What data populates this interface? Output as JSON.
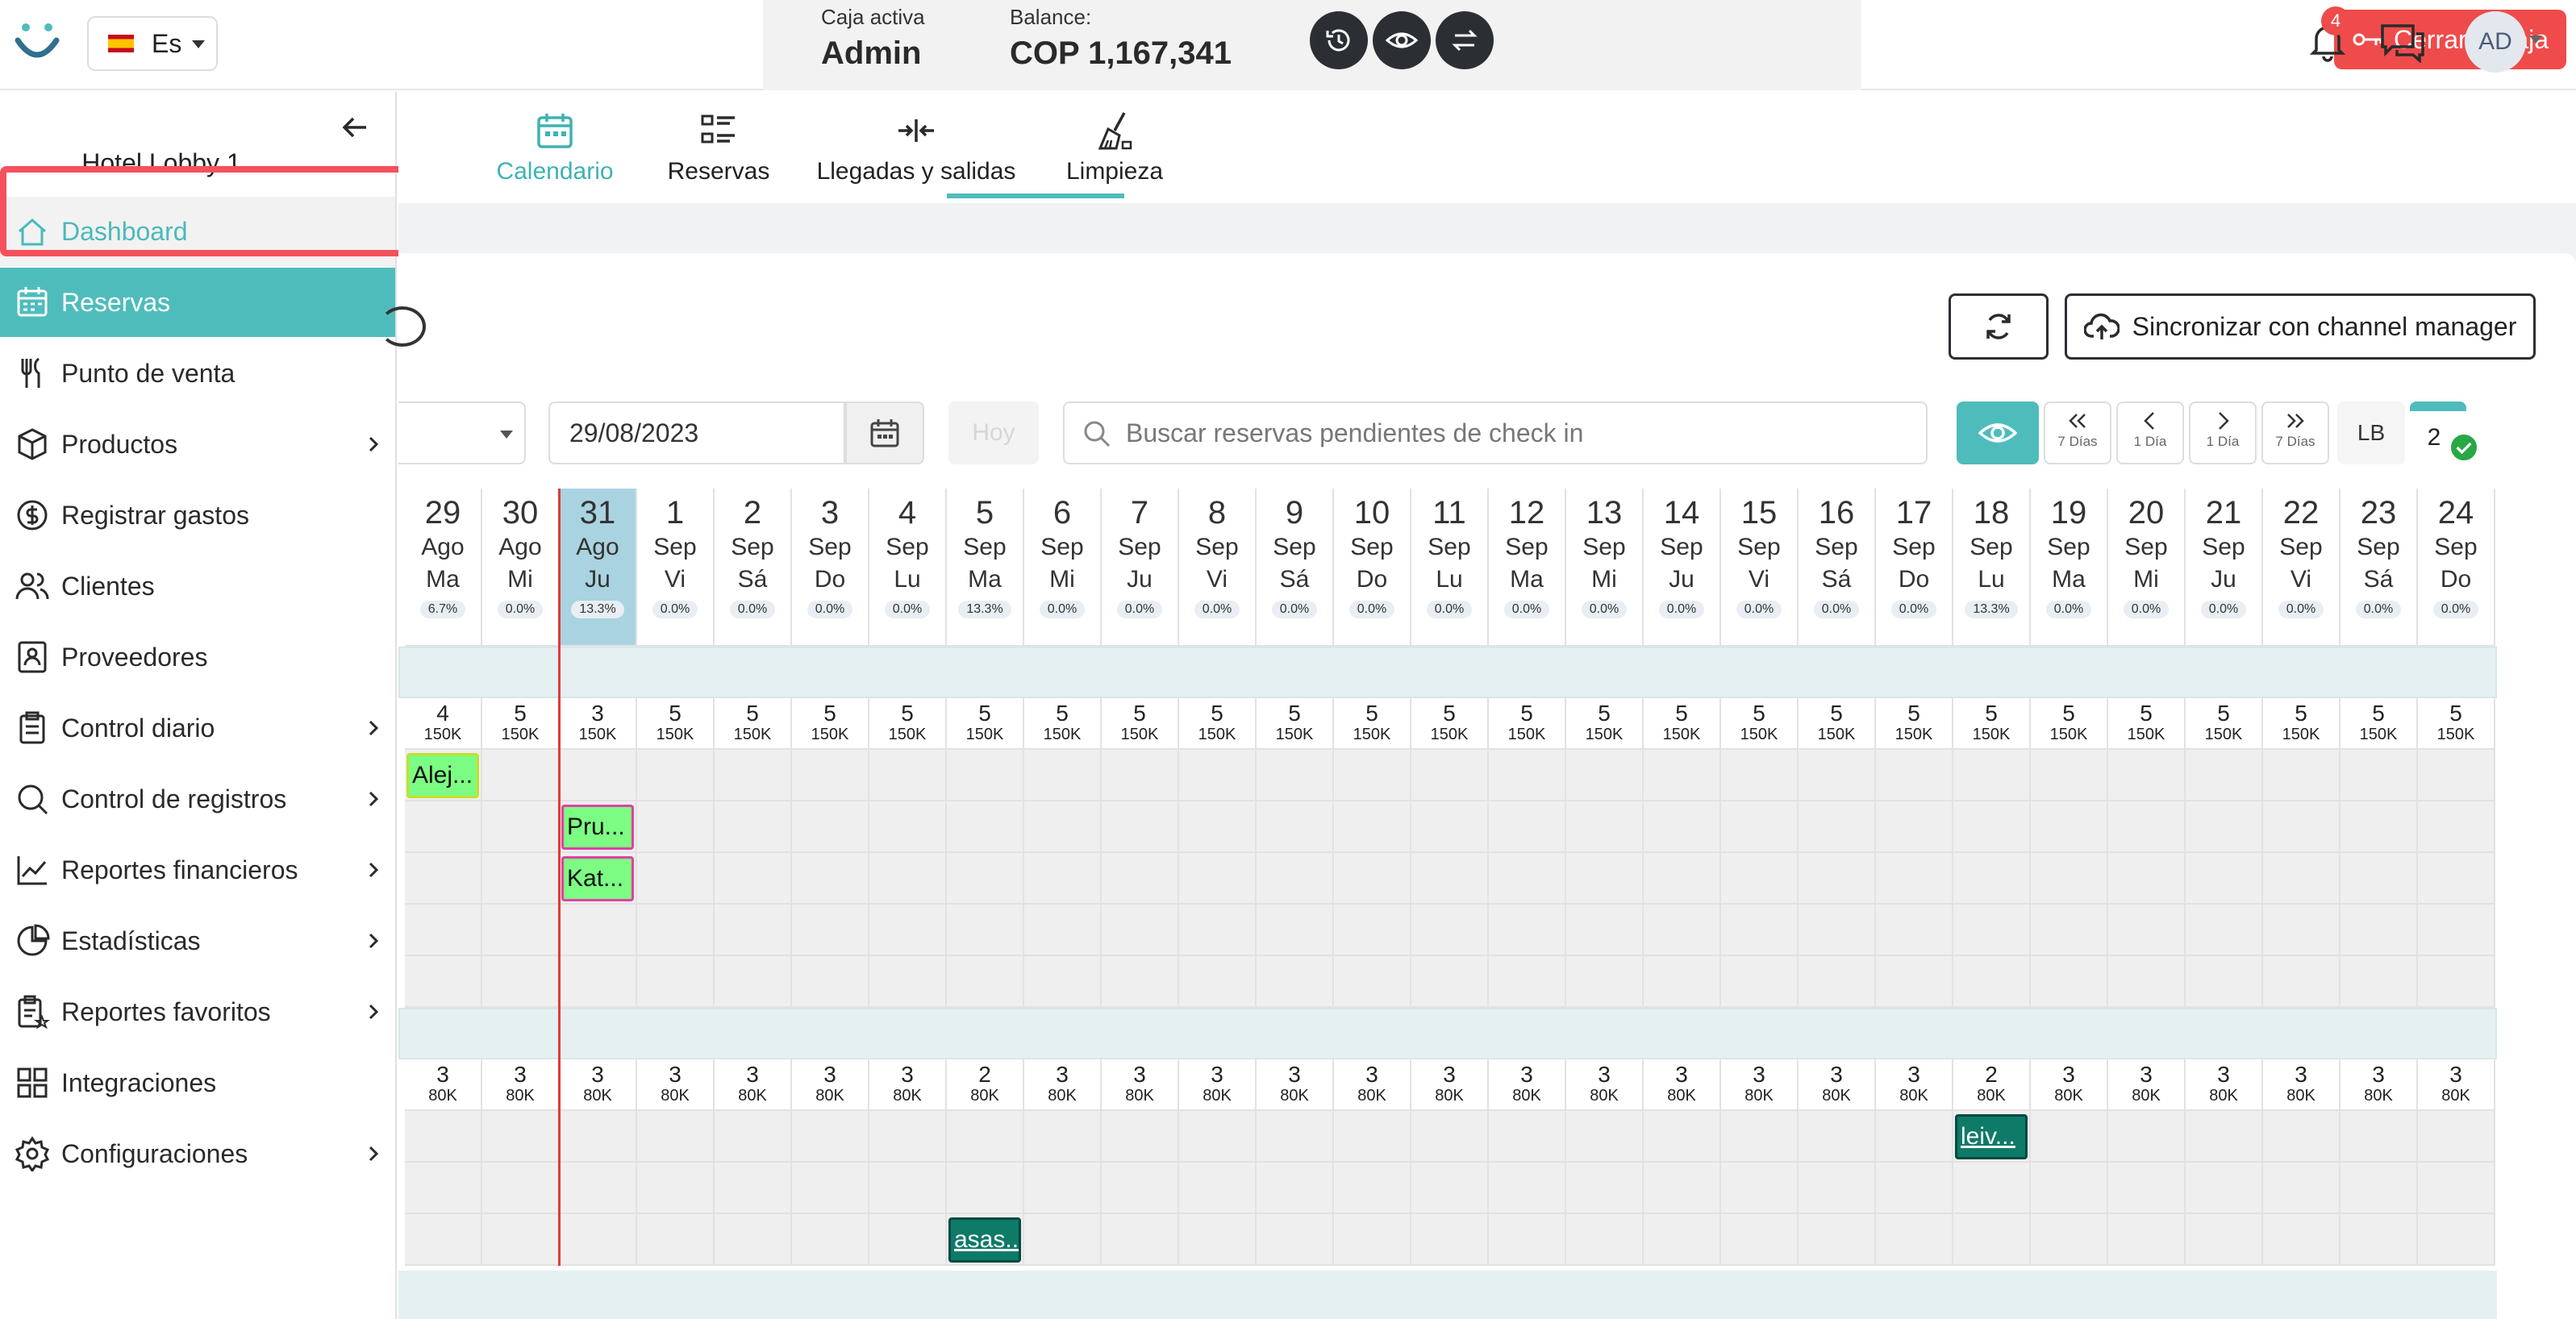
{
  "header": {
    "language": "Es",
    "cash": {
      "active_label": "Caja activa",
      "active_value": "Admin",
      "balance_label": "Balance:",
      "balance_value": "COP 1,167,341"
    },
    "close_cash_label": "Cerrar la caja",
    "notifications_count": "4",
    "avatar_initials": "AD"
  },
  "sidebar": {
    "hotel_name": "Hotel Lobby 1",
    "items": [
      {
        "label": "Dashboard",
        "icon": "home-icon"
      },
      {
        "label": "Reservas",
        "icon": "calendar-icon"
      },
      {
        "label": "Punto de venta",
        "icon": "utensils-icon"
      },
      {
        "label": "Productos",
        "icon": "box-icon"
      },
      {
        "label": "Registrar gastos",
        "icon": "dollar-circle-icon"
      },
      {
        "label": "Clientes",
        "icon": "users-icon"
      },
      {
        "label": "Proveedores",
        "icon": "contact-card-icon"
      },
      {
        "label": "Control diario",
        "icon": "clipboard-icon"
      },
      {
        "label": "Control de registros",
        "icon": "search-icon"
      },
      {
        "label": "Reportes financieros",
        "icon": "line-chart-icon"
      },
      {
        "label": "Estadísticas",
        "icon": "pie-chart-icon"
      },
      {
        "label": "Reportes favoritos",
        "icon": "clipboard-star-icon"
      },
      {
        "label": "Integraciones",
        "icon": "grid-icon"
      },
      {
        "label": "Configuraciones",
        "icon": "gear-icon"
      }
    ]
  },
  "tabs": [
    {
      "label": "Calendario",
      "icon": "calendar-icon"
    },
    {
      "label": "Reservas",
      "icon": "list-icon"
    },
    {
      "label": "Llegadas y salidas",
      "icon": "arrows-icon"
    },
    {
      "label": "Limpieza",
      "icon": "broom-icon"
    }
  ],
  "toolbar": {
    "sync_label": "Sincronizar con channel manager",
    "date_value": "29/08/2023",
    "today_label": "Hoy",
    "search_placeholder": "Buscar reservas pendientes de check in",
    "nav": [
      {
        "sub": "7 Días"
      },
      {
        "sub": "1 Día"
      },
      {
        "sub": "1 Día"
      },
      {
        "sub": "7 Días"
      }
    ],
    "lb_label": "LB",
    "count": "2"
  },
  "calendar": {
    "days": [
      {
        "num": "29",
        "mon": "Ago",
        "dow": "Ma",
        "occ": "6.7%"
      },
      {
        "num": "30",
        "mon": "Ago",
        "dow": "Mi",
        "occ": "0.0%"
      },
      {
        "num": "31",
        "mon": "Ago",
        "dow": "Ju",
        "occ": "13.3%",
        "today": true
      },
      {
        "num": "1",
        "mon": "Sep",
        "dow": "Vi",
        "occ": "0.0%"
      },
      {
        "num": "2",
        "mon": "Sep",
        "dow": "Sá",
        "occ": "0.0%"
      },
      {
        "num": "3",
        "mon": "Sep",
        "dow": "Do",
        "occ": "0.0%"
      },
      {
        "num": "4",
        "mon": "Sep",
        "dow": "Lu",
        "occ": "0.0%"
      },
      {
        "num": "5",
        "mon": "Sep",
        "dow": "Ma",
        "occ": "13.3%"
      },
      {
        "num": "6",
        "mon": "Sep",
        "dow": "Mi",
        "occ": "0.0%"
      },
      {
        "num": "7",
        "mon": "Sep",
        "dow": "Ju",
        "occ": "0.0%"
      },
      {
        "num": "8",
        "mon": "Sep",
        "dow": "Vi",
        "occ": "0.0%"
      },
      {
        "num": "9",
        "mon": "Sep",
        "dow": "Sá",
        "occ": "0.0%"
      },
      {
        "num": "10",
        "mon": "Sep",
        "dow": "Do",
        "occ": "0.0%"
      },
      {
        "num": "11",
        "mon": "Sep",
        "dow": "Lu",
        "occ": "0.0%"
      },
      {
        "num": "12",
        "mon": "Sep",
        "dow": "Ma",
        "occ": "0.0%"
      },
      {
        "num": "13",
        "mon": "Sep",
        "dow": "Mi",
        "occ": "0.0%"
      },
      {
        "num": "14",
        "mon": "Sep",
        "dow": "Ju",
        "occ": "0.0%"
      },
      {
        "num": "15",
        "mon": "Sep",
        "dow": "Vi",
        "occ": "0.0%"
      },
      {
        "num": "16",
        "mon": "Sep",
        "dow": "Sá",
        "occ": "0.0%"
      },
      {
        "num": "17",
        "mon": "Sep",
        "dow": "Do",
        "occ": "0.0%"
      },
      {
        "num": "18",
        "mon": "Sep",
        "dow": "Lu",
        "occ": "13.3%"
      },
      {
        "num": "19",
        "mon": "Sep",
        "dow": "Ma",
        "occ": "0.0%"
      },
      {
        "num": "20",
        "mon": "Sep",
        "dow": "Mi",
        "occ": "0.0%"
      },
      {
        "num": "21",
        "mon": "Sep",
        "dow": "Ju",
        "occ": "0.0%"
      },
      {
        "num": "22",
        "mon": "Sep",
        "dow": "Vi",
        "occ": "0.0%"
      },
      {
        "num": "23",
        "mon": "Sep",
        "dow": "Sá",
        "occ": "0.0%"
      },
      {
        "num": "24",
        "mon": "Sep",
        "dow": "Do",
        "occ": "0.0%"
      }
    ],
    "group1": {
      "avail": [
        "4",
        "5",
        "3",
        "5",
        "5",
        "5",
        "5",
        "5",
        "5",
        "5",
        "5",
        "5",
        "5",
        "5",
        "5",
        "5",
        "5",
        "5",
        "5",
        "5",
        "5",
        "5",
        "5",
        "5",
        "5",
        "5",
        "5"
      ],
      "price": "150K",
      "room_rows": 5
    },
    "group2": {
      "avail": [
        "3",
        "3",
        "3",
        "3",
        "3",
        "3",
        "3",
        "2",
        "3",
        "3",
        "3",
        "3",
        "3",
        "3",
        "3",
        "3",
        "3",
        "3",
        "3",
        "3",
        "2",
        "3",
        "3",
        "3",
        "3",
        "3",
        "3"
      ],
      "price": "80K",
      "room_rows": 3
    },
    "bookings": [
      {
        "label": "Alej...",
        "group": 1,
        "row": 0,
        "day": 0,
        "style": "bk-green-y"
      },
      {
        "label": "Pru...",
        "group": 1,
        "row": 1,
        "day": 2,
        "style": "bk-green-p"
      },
      {
        "label": "Kat...",
        "group": 1,
        "row": 2,
        "day": 2,
        "style": "bk-green-p"
      },
      {
        "label": "leiv...",
        "group": 2,
        "row": 0,
        "day": 20,
        "style": "bk-teal"
      },
      {
        "label": "asas...",
        "group": 2,
        "row": 2,
        "day": 7,
        "style": "bk-teal"
      }
    ]
  }
}
